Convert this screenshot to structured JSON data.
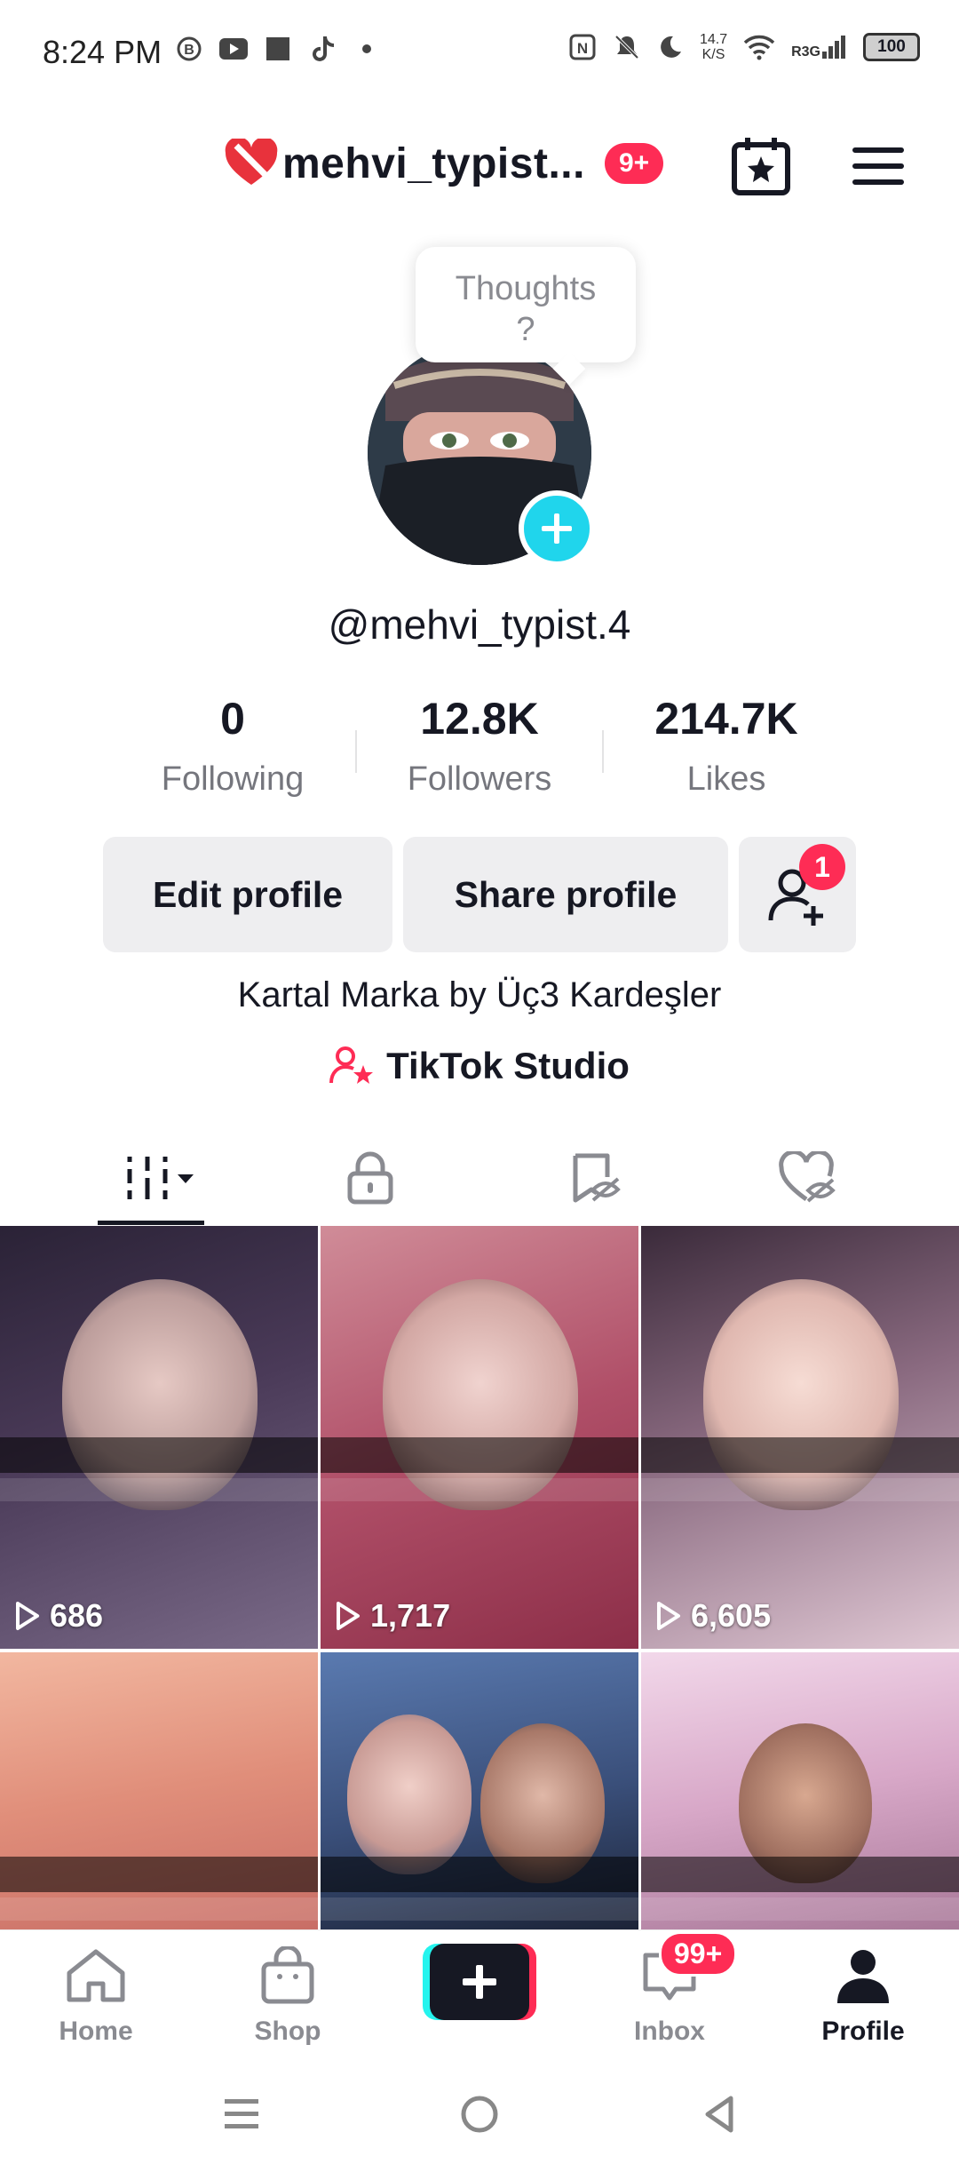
{
  "status_bar": {
    "time": "8:24 PM",
    "net_speed_value": "14.7",
    "net_speed_unit": "K/S",
    "signal_label": "R3G",
    "battery": "100"
  },
  "header": {
    "username": "mehvi_typist...",
    "notification_badge": "9+"
  },
  "profile": {
    "tooltip_line1": "Thoughts",
    "tooltip_line2": "?",
    "handle": "@mehvi_typist.4",
    "stats": {
      "following_count": "0",
      "following_label": "Following",
      "followers_count": "12.8K",
      "followers_label": "Followers",
      "likes_count": "214.7K",
      "likes_label": "Likes"
    },
    "edit_profile_label": "Edit profile",
    "share_profile_label": "Share profile",
    "friend_requests_badge": "1",
    "bio": "Kartal Marka by Üç3 Kardeşler",
    "studio_label": "TikTok Studio"
  },
  "videos": [
    {
      "views": "686"
    },
    {
      "views": "1,717"
    },
    {
      "views": "6,605"
    }
  ],
  "bottom_nav": {
    "home": "Home",
    "shop": "Shop",
    "inbox": "Inbox",
    "inbox_badge": "99+",
    "profile": "Profile"
  },
  "colors": {
    "accent_red": "#fe2c55",
    "accent_cyan": "#20d5ec",
    "text_primary": "#161823",
    "text_secondary": "#75767d"
  }
}
